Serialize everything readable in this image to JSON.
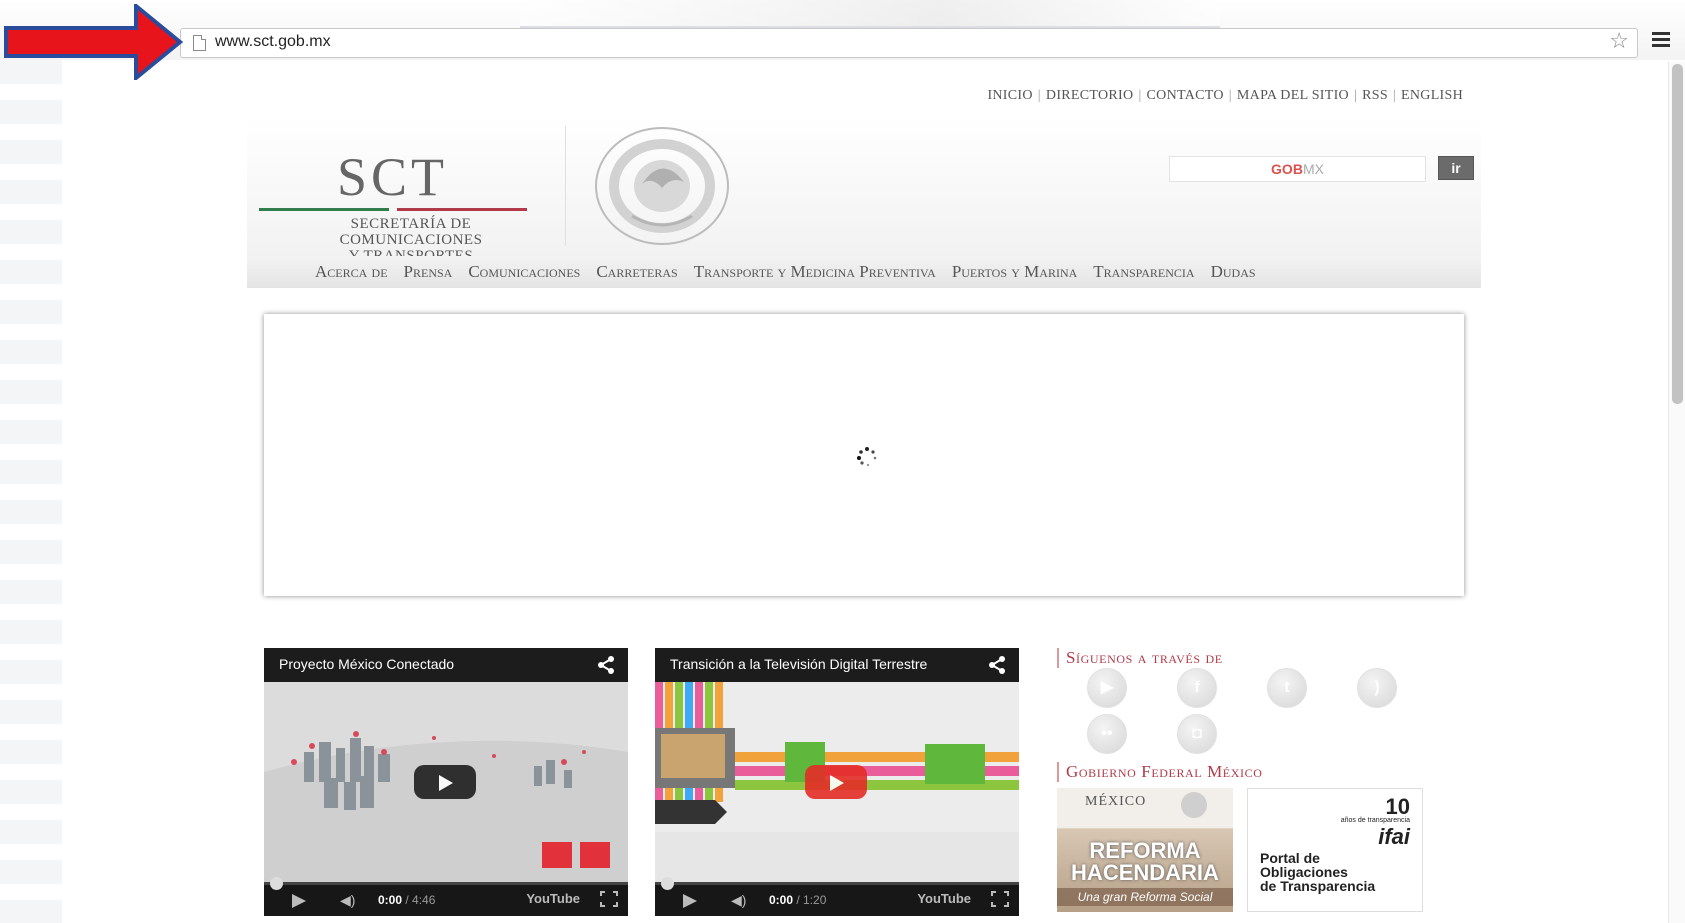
{
  "browser": {
    "url": "www.sct.gob.mx"
  },
  "utility_nav": [
    "INICIO",
    "DIRECTORIO",
    "CONTACTO",
    "MAPA DEL SITIO",
    "RSS",
    "ENGLISH"
  ],
  "logo": {
    "acronym": "SCT",
    "line1": "SECRETARÍA DE",
    "line2": "COMUNICACIONES",
    "line3": "Y TRANSPORTES"
  },
  "search": {
    "placeholder_gob": "GOB",
    "placeholder_mx": "MX",
    "button_label": "ir"
  },
  "main_nav": [
    "Acerca de",
    "Prensa",
    "Comunicaciones",
    "Carreteras",
    "Transporte y Medicina Preventiva",
    "Puertos y Marina",
    "Transparencia",
    "Dudas"
  ],
  "videos": [
    {
      "title": "Proyecto México Conectado",
      "time": "0:00",
      "duration": "/ 4:46"
    },
    {
      "title": "Transición a la Televisión Digital Terrestre",
      "time": "0:00",
      "duration": "/ 1:20"
    }
  ],
  "youtube_label": "YouTube",
  "sidebar": {
    "follow_heading": "Síguenos a través de",
    "government_heading": "Gobierno Federal México",
    "social_icons": [
      "youtube-icon",
      "facebook-icon",
      "twitter-icon",
      "rss-icon",
      "flickr-icon",
      "android-icon"
    ],
    "banner_reforma": {
      "country": "MÉXICO",
      "line1": "REFORMA",
      "line2": "HACENDARIA",
      "tagline": "Una gran Reforma Social"
    },
    "banner_ifai": {
      "years_number": "10",
      "years_text": "años de transparencia",
      "brand": "ifai",
      "line1": "Portal de",
      "line2": "Obligaciones",
      "line3": "de Transparencia"
    }
  },
  "colors": {
    "accent_red": "#b23a48",
    "logo_green": "#2e7d4a",
    "arrow_red": "#e8141c",
    "arrow_border": "#2a4c9c"
  }
}
